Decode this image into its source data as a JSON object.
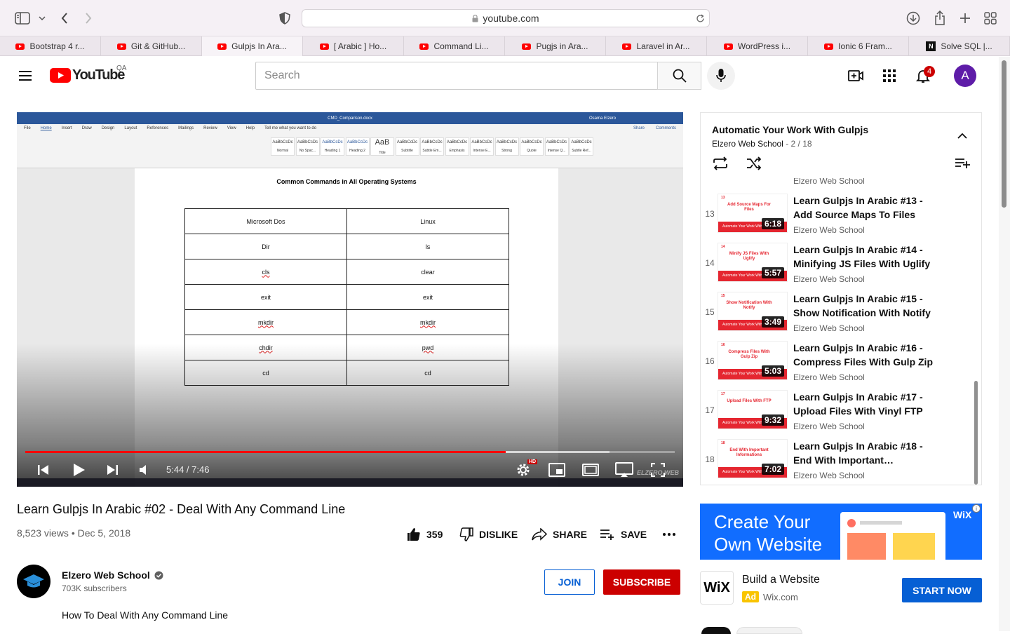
{
  "browser": {
    "url": "youtube.com",
    "tabs": [
      {
        "label": "Bootstrap 4 r...",
        "favicon": "youtube-icon",
        "active": false
      },
      {
        "label": "Git & GitHub...",
        "favicon": "youtube-icon",
        "active": false
      },
      {
        "label": "Gulpjs In Ara...",
        "favicon": "youtube-icon",
        "active": true
      },
      {
        "label": "[ Arabic ] Ho...",
        "favicon": "youtube-icon",
        "active": false
      },
      {
        "label": "Command Li...",
        "favicon": "youtube-icon",
        "active": false
      },
      {
        "label": "Pugjs in Ara...",
        "favicon": "youtube-icon",
        "active": false
      },
      {
        "label": "Laravel in Ar...",
        "favicon": "youtube-icon",
        "active": false
      },
      {
        "label": "WordPress i...",
        "favicon": "youtube-icon",
        "active": false
      },
      {
        "label": "Ionic 6 Fram...",
        "favicon": "youtube-icon",
        "active": false
      },
      {
        "label": "Solve SQL |...",
        "favicon": "n-icon",
        "active": false
      }
    ]
  },
  "header": {
    "logo_text": "YouTube",
    "region": "QA",
    "search_placeholder": "Search",
    "notification_count": "4",
    "avatar_letter": "A"
  },
  "player": {
    "time": "5:44 / 7:46",
    "progress_played": 0.74,
    "progress_loaded": 0.9,
    "hd_badge": "HD",
    "watermark": "ELZERO WEB",
    "doc": {
      "filename": "CMD_Comparison.docx",
      "author": "Osama Elzero",
      "ribbon_tabs": [
        "File",
        "Home",
        "Insert",
        "Draw",
        "Design",
        "Layout",
        "References",
        "Mailings",
        "Review",
        "View",
        "Help",
        "Tell me what you want to do"
      ],
      "ribbon_right": [
        "Share",
        "Comments"
      ],
      "styles": [
        "Normal",
        "No Spac...",
        "Heading 1",
        "Heading 2",
        "Title",
        "Subtitle",
        "Subtle Em...",
        "Emphasis",
        "Intense E...",
        "Strong",
        "Quote",
        "Intense Q...",
        "Subtle Ref..."
      ],
      "title": "Common Commands in All Operating Systems",
      "table": [
        [
          "Microsoft Dos",
          "Linux"
        ],
        [
          "Dir",
          "ls"
        ],
        [
          "cls",
          "clear"
        ],
        [
          "exit",
          "exit"
        ],
        [
          "mkdir",
          "mkdir"
        ],
        [
          "chdir",
          "pwd"
        ],
        [
          "cd",
          "cd"
        ]
      ]
    }
  },
  "video": {
    "title": "Learn Gulpjs In Arabic #02 - Deal With Any Command Line",
    "meta": "8,523 views • Dec 5, 2018",
    "likes": "359",
    "dislike_label": "DISLIKE",
    "share_label": "SHARE",
    "save_label": "SAVE"
  },
  "channel": {
    "name": "Elzero Web School",
    "subscribers": "703K subscribers",
    "join_label": "JOIN",
    "subscribe_label": "SUBSCRIBE",
    "description": "How To Deal With Any Command Line"
  },
  "playlist": {
    "title": "Automatic Your Work With Gulpjs",
    "channel": "Elzero Web School",
    "position": "- 2 / 18",
    "partial_channel": "Elzero Web School",
    "items": [
      {
        "index": "13",
        "title": "Learn Gulpjs In Arabic #13 - Add Source Maps To Files",
        "channel": "Elzero Web School",
        "duration": "6:18",
        "thumb_text": "Add Source Maps For Files"
      },
      {
        "index": "14",
        "title": "Learn Gulpjs In Arabic #14 - Minifying JS Files With Uglify",
        "channel": "Elzero Web School",
        "duration": "5:57",
        "thumb_text": "Minify JS Files With Uglify"
      },
      {
        "index": "15",
        "title": "Learn Gulpjs In Arabic #15 - Show Notification With Notify",
        "channel": "Elzero Web School",
        "duration": "3:49",
        "thumb_text": "Show Notification With Notify"
      },
      {
        "index": "16",
        "title": "Learn Gulpjs In Arabic #16 - Compress Files With Gulp Zip",
        "channel": "Elzero Web School",
        "duration": "5:03",
        "thumb_text": "Compress Files With Gulp Zip"
      },
      {
        "index": "17",
        "title": "Learn Gulpjs In Arabic #17 - Upload Files With Vinyl FTP",
        "channel": "Elzero Web School",
        "duration": "9:32",
        "thumb_text": "Upload Files With FTP"
      },
      {
        "index": "18",
        "title": "Learn Gulpjs In Arabic #18 - End With Important…",
        "channel": "Elzero Web School",
        "duration": "7:02",
        "thumb_text": "End With Important Informations"
      }
    ],
    "thumb_band": "Automate Your Work With Gulp"
  },
  "ad": {
    "headline_line1": "Create Your",
    "headline_line2": "Own Website",
    "brand_mark": "WiX",
    "logo": "WiX",
    "title": "Build a Website",
    "tag": "Ad",
    "domain": "Wix.com",
    "cta": "START NOW"
  },
  "colors": {
    "youtube_red": "#ff0000",
    "subscribe_red": "#cc0000",
    "link_blue": "#065fd4",
    "avatar_purple": "#5e1ca8",
    "ad_blue": "#116dff"
  }
}
